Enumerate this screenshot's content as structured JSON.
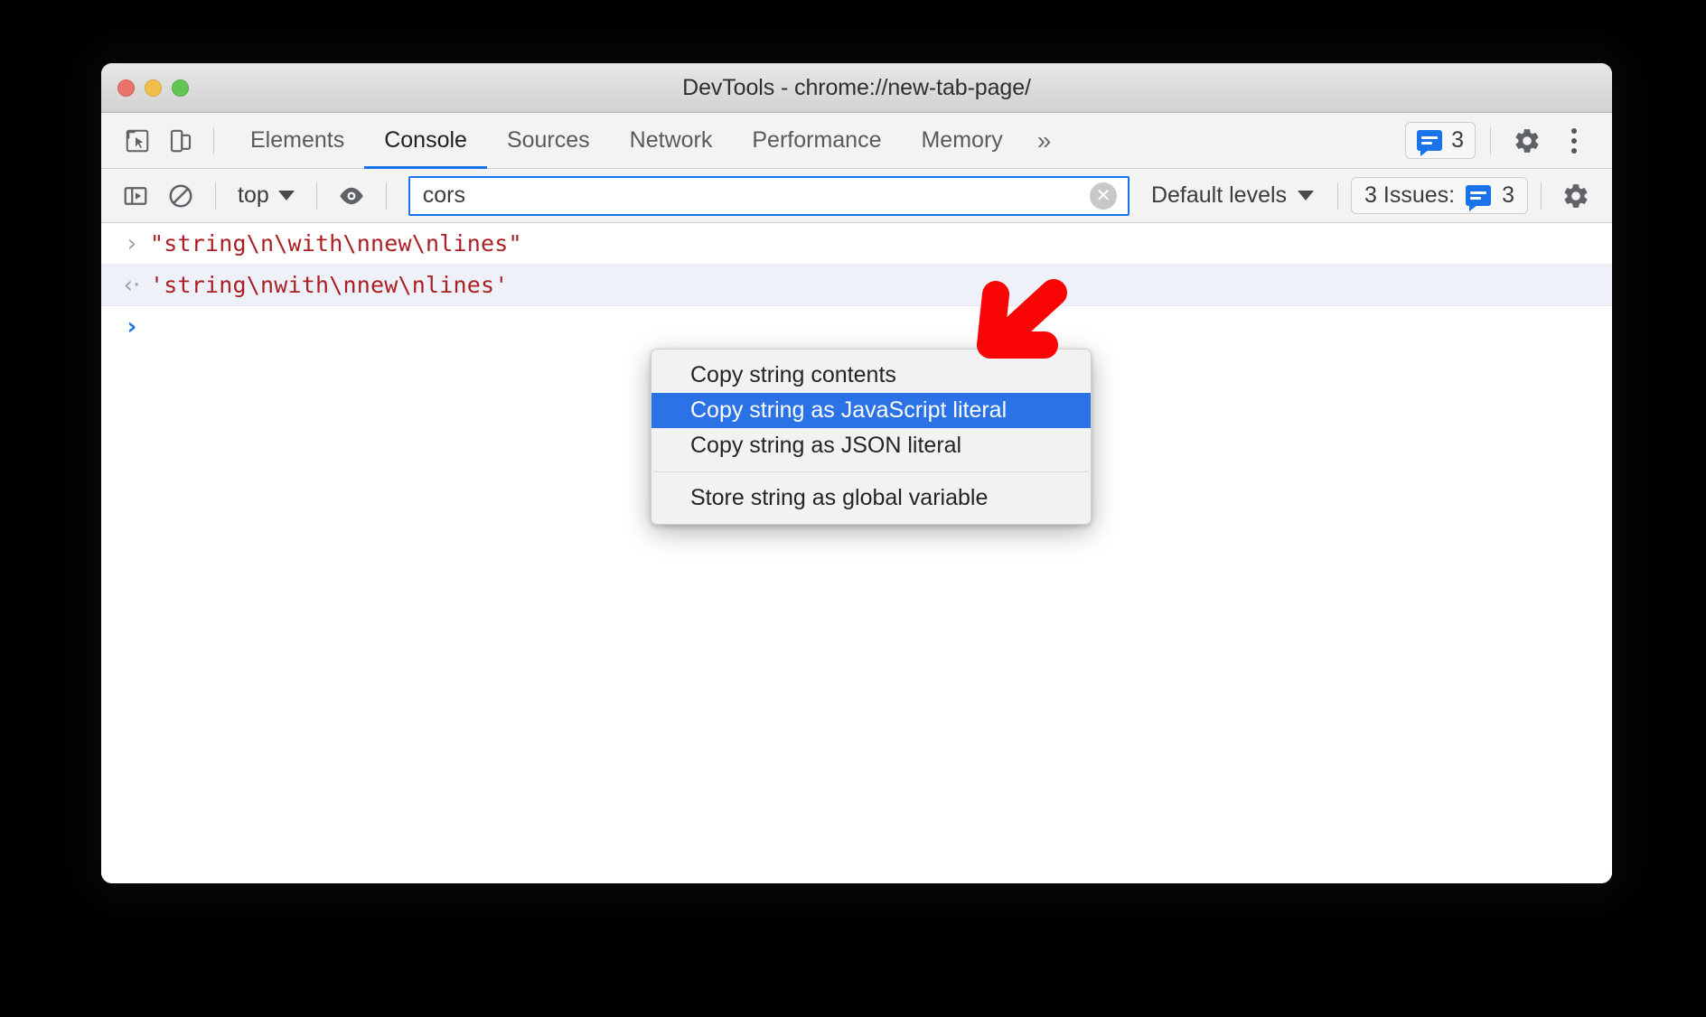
{
  "window": {
    "title": "DevTools - chrome://new-tab-page/",
    "traffic_lights": [
      {
        "name": "close",
        "color": "#e9736b"
      },
      {
        "name": "minimize",
        "color": "#f1bd4c"
      },
      {
        "name": "maximize",
        "color": "#63c554"
      }
    ]
  },
  "main_toolbar": {
    "inspect_icon": "inspect-element-icon",
    "device_icon": "device-toolbar-icon",
    "tabs": [
      {
        "label": "Elements",
        "active": false
      },
      {
        "label": "Console",
        "active": true
      },
      {
        "label": "Sources",
        "active": false
      },
      {
        "label": "Network",
        "active": false
      },
      {
        "label": "Performance",
        "active": false
      },
      {
        "label": "Memory",
        "active": false
      }
    ],
    "more_tabs": "»",
    "issues_badge": {
      "icon": "message-icon",
      "count": "3"
    },
    "settings_icon": "gear-icon",
    "menu_icon": "kebab-menu-icon"
  },
  "filter_toolbar": {
    "sidebar_icon": "console-sidebar-icon",
    "clear_icon": "clear-console-icon",
    "context": {
      "label": "top",
      "caret": "▼"
    },
    "eye_icon": "live-expression-icon",
    "filter": {
      "value": "cors",
      "placeholder": "Filter",
      "clear_icon": "clear-input-icon"
    },
    "levels": {
      "label": "Default levels",
      "caret": "▼"
    },
    "issues": {
      "label": "3 Issues:",
      "icon": "message-icon",
      "count": "3"
    },
    "settings_icon": "gear-icon"
  },
  "console": {
    "rows": [
      {
        "type": "input",
        "gutter": "›",
        "text": "\"string\\n\\with\\nnew\\nlines\""
      },
      {
        "type": "result",
        "gutter": "‹·",
        "text": "'string\\nwith\\nnew\\nlines'"
      }
    ],
    "prompt": {
      "chevron": "›",
      "value": ""
    }
  },
  "context_menu": {
    "items": [
      {
        "label": "Copy string contents",
        "selected": false,
        "divider_after": false
      },
      {
        "label": "Copy string as JavaScript literal",
        "selected": true,
        "divider_after": false
      },
      {
        "label": "Copy string as JSON literal",
        "selected": false,
        "divider_after": true
      },
      {
        "label": "Store string as global variable",
        "selected": false,
        "divider_after": false
      }
    ]
  },
  "annotation": {
    "arrow_color": "#fa0505",
    "points_to": "Copy string as JavaScript literal"
  },
  "colors": {
    "accent": "#1a73e8",
    "menu_selected": "#2a72e5",
    "string_text": "#ab1f24",
    "toolbar_bg": "#f3f3f3"
  }
}
